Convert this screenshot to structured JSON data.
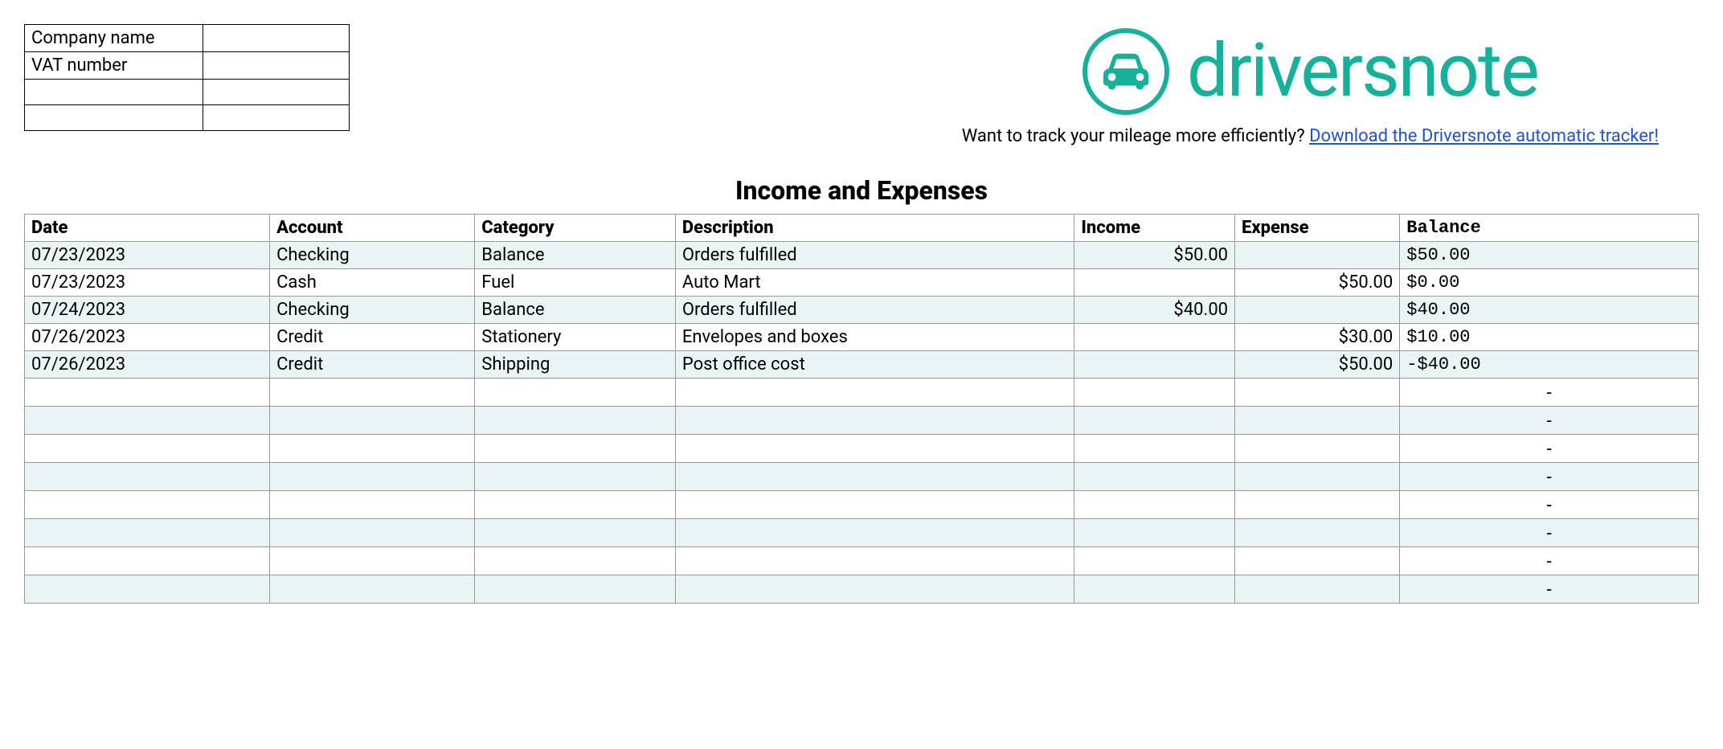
{
  "company_info": {
    "rows": [
      {
        "label": "Company name",
        "value": ""
      },
      {
        "label": "VAT number",
        "value": ""
      },
      {
        "label": "",
        "value": ""
      },
      {
        "label": "",
        "value": ""
      }
    ]
  },
  "logo": {
    "brand_text": "driversnote",
    "accent_color": "#16b09b"
  },
  "cta": {
    "prefix": "Want to track your mileage more efficiently? ",
    "link_text": "Download the Driversnote automatic tracker!"
  },
  "section_title": "Income and Expenses",
  "table_headers": {
    "date": "Date",
    "account": "Account",
    "category": "Category",
    "description": "Description",
    "income": "Income",
    "expense": "Expense",
    "balance": "Balance"
  },
  "rows": [
    {
      "date": "07/23/2023",
      "account": "Checking",
      "category": "Balance",
      "description": "Orders fulfilled",
      "income": "$50.00",
      "expense": "",
      "balance": "$50.00"
    },
    {
      "date": "07/23/2023",
      "account": "Cash",
      "category": "Fuel",
      "description": "Auto Mart",
      "income": "",
      "expense": "$50.00",
      "balance": "$0.00"
    },
    {
      "date": "07/24/2023",
      "account": "Checking",
      "category": "Balance",
      "description": "Orders fulfilled",
      "income": "$40.00",
      "expense": "",
      "balance": "$40.00"
    },
    {
      "date": "07/26/2023",
      "account": "Credit",
      "category": "Stationery",
      "description": "Envelopes and boxes",
      "income": "",
      "expense": "$30.00",
      "balance": "$10.00"
    },
    {
      "date": "07/26/2023",
      "account": "Credit",
      "category": "Shipping",
      "description": "Post office cost",
      "income": "",
      "expense": "$50.00",
      "balance": "-$40.00"
    }
  ],
  "empty_rows": [
    {
      "balance": "-"
    },
    {
      "balance": "-"
    },
    {
      "balance": "-"
    },
    {
      "balance": "-"
    },
    {
      "balance": "-"
    },
    {
      "balance": "-"
    },
    {
      "balance": "-"
    },
    {
      "balance": "-"
    }
  ]
}
